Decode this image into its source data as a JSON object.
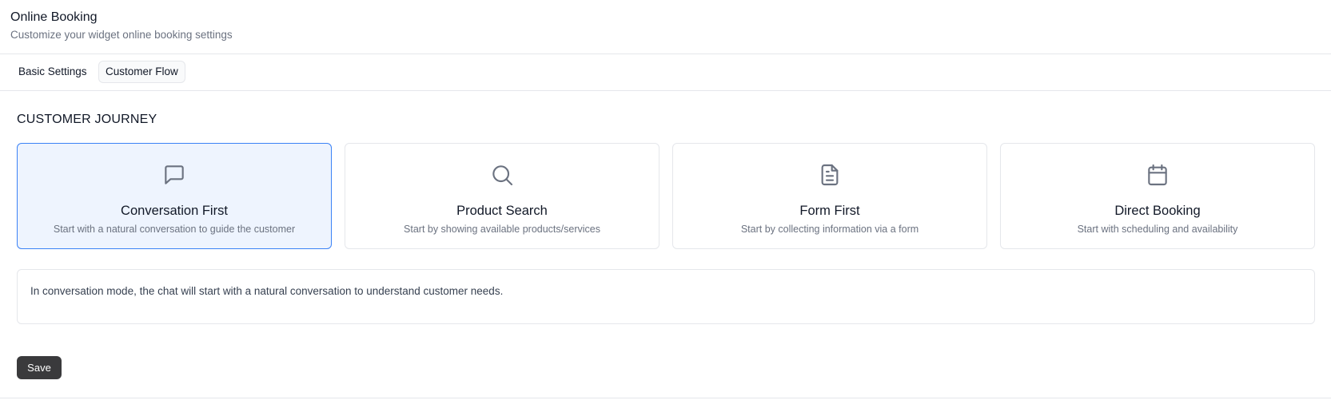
{
  "header": {
    "title": "Online Booking",
    "subtitle": "Customize your widget online booking settings"
  },
  "tabs": [
    {
      "label": "Basic Settings",
      "active": false
    },
    {
      "label": "Customer Flow",
      "active": true
    }
  ],
  "section": {
    "heading": "CUSTOMER JOURNEY"
  },
  "cards": [
    {
      "icon": "chat-bubble-icon",
      "title": "Conversation First",
      "description": "Start with a natural conversation to guide the customer",
      "selected": true
    },
    {
      "icon": "search-icon",
      "title": "Product Search",
      "description": "Start by showing available products/services",
      "selected": false
    },
    {
      "icon": "document-icon",
      "title": "Form First",
      "description": "Start by collecting information via a form",
      "selected": false
    },
    {
      "icon": "calendar-icon",
      "title": "Direct Booking",
      "description": "Start with scheduling and availability",
      "selected": false
    }
  ],
  "info": {
    "text": "In conversation mode, the chat will start with a natural conversation to understand customer needs."
  },
  "actions": {
    "save_label": "Save"
  },
  "colors": {
    "selected_border": "#3b82f6",
    "selected_background": "#eef4fe",
    "icon": "#6b7280",
    "save_button": "#3a3a3c"
  }
}
